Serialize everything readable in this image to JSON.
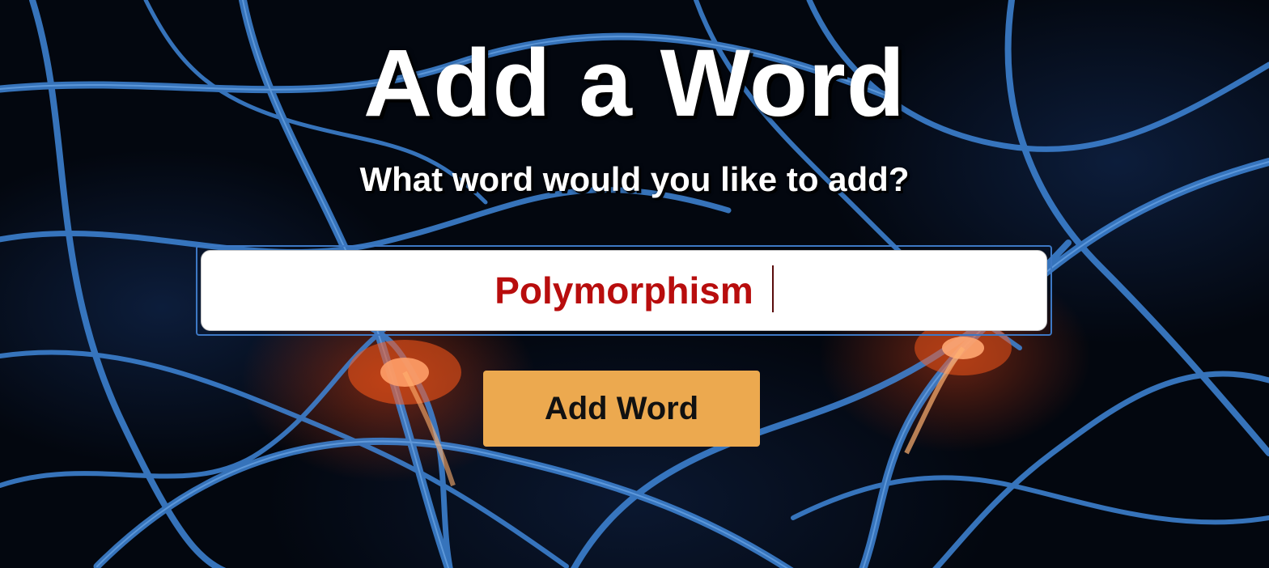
{
  "page": {
    "title": "Add a Word",
    "subtitle": "What word would you like to add?"
  },
  "form": {
    "word_value": "Polymorphism",
    "submit_label": "Add Word"
  },
  "colors": {
    "button_background": "#eca94f",
    "input_text": "#b80d0d",
    "focus_ring": "#3d78c4",
    "heading_text": "#ffffff"
  }
}
